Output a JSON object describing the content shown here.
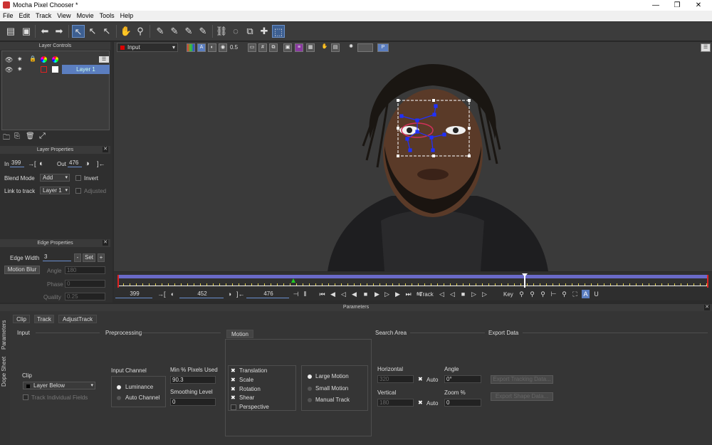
{
  "window": {
    "title": "Mocha Pixel Chooser *",
    "min": "—",
    "max": "❐",
    "close": "✕"
  },
  "menu": [
    "File",
    "Edit",
    "Track",
    "View",
    "Movie",
    "Tools",
    "Help"
  ],
  "toolbar_icons": [
    "open-icon",
    "save-icon",
    "undo-icon",
    "redo-icon",
    "select-icon",
    "select-b-icon",
    "select-plus-icon",
    "hand-icon",
    "zoom-icon",
    "add-x-spline-icon",
    "add-x-plus-icon",
    "add-b-spline-icon",
    "add-b-plus-icon",
    "link-icon",
    "lasso-icon",
    "transform-icon",
    "move-icon",
    "surface-icon"
  ],
  "viewer_toolbar": {
    "input_label": "Input",
    "zoom_value": "0.5",
    "p_label": "P"
  },
  "layer_controls": {
    "title": "Layer Controls",
    "layer_name": "Layer 1"
  },
  "layer_properties": {
    "title": "Layer Properties",
    "in_label": "In",
    "in_value": "399",
    "out_label": "Out",
    "out_value": "476",
    "blend_label": "Blend Mode",
    "blend_value": "Add",
    "invert_label": "Invert",
    "link_label": "Link to track",
    "link_value": "Layer 1",
    "adjusted_label": "Adjusted"
  },
  "edge_properties": {
    "title": "Edge Properties",
    "edge_width_label": "Edge Width",
    "edge_width_value": "3",
    "minus": "-",
    "set": "Set",
    "plus": "+",
    "motion_blur": "Motion Blur",
    "angle_label": "Angle",
    "angle_value": "180",
    "phase_label": "Phase",
    "phase_value": "0",
    "quality_label": "Quality",
    "quality_value": "0.25"
  },
  "transport": {
    "start": "399",
    "current": "452",
    "end": "476",
    "track_label": "Track",
    "key_label": "Key"
  },
  "params_bar": "Parameters",
  "side_tabs": [
    "Parameters",
    "Dope Sheet"
  ],
  "tabs": [
    "Clip",
    "Track",
    "AdjustTrack"
  ],
  "input": {
    "title": "Input",
    "clip_label": "Clip",
    "clip_value": "Layer Below",
    "track_individual": "Track Individual Fields"
  },
  "preprocessing": {
    "title": "Preprocessing",
    "input_channel": "Input Channel",
    "luminance": "Luminance",
    "auto_channel": "Auto Channel",
    "min_pixels_label": "Min % Pixels Used",
    "min_pixels_value": "90.3",
    "smoothing_label": "Smoothing Level",
    "smoothing_value": "0"
  },
  "motion": {
    "title": "Motion",
    "translation": "Translation",
    "scale": "Scale",
    "rotation": "Rotation",
    "shear": "Shear",
    "perspective": "Perspective",
    "large": "Large Motion",
    "small": "Small Motion",
    "manual": "Manual Track"
  },
  "search_area": {
    "title": "Search Area",
    "horizontal": "Horizontal",
    "horizontal_value": "320",
    "vertical": "Vertical",
    "vertical_value": "180",
    "auto": "Auto",
    "angle": "Angle",
    "angle_value": "0°",
    "zoom": "Zoom %",
    "zoom_value": "0"
  },
  "export_data": {
    "title": "Export Data",
    "tracking": "Export Tracking Data...",
    "shape": "Export Shape Data..."
  }
}
